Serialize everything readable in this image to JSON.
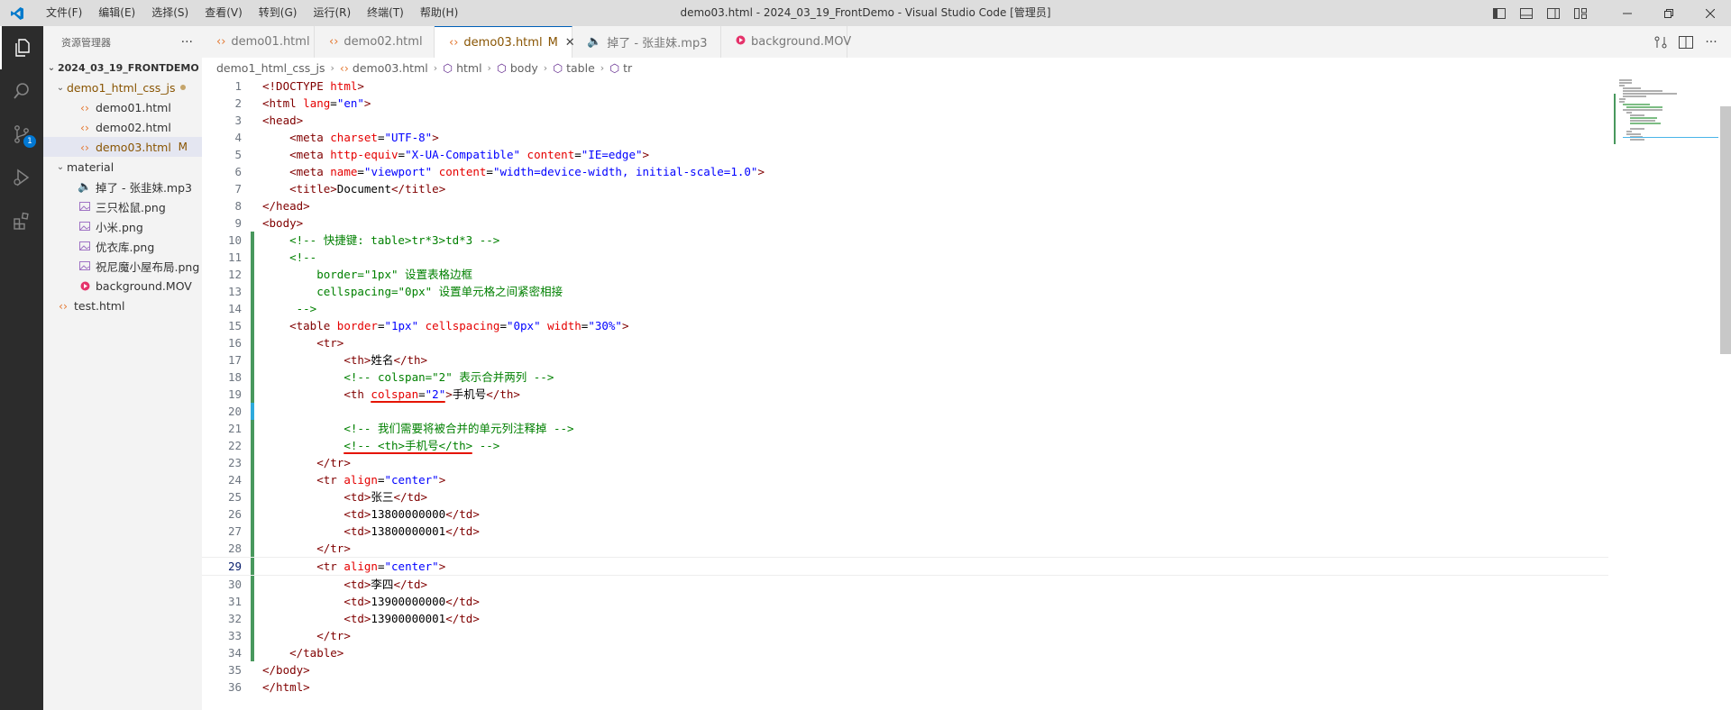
{
  "title_bar": {
    "menu": [
      "文件(F)",
      "编辑(E)",
      "选择(S)",
      "查看(V)",
      "转到(G)",
      "运行(R)",
      "终端(T)",
      "帮助(H)"
    ],
    "window_title": "demo03.html - 2024_03_19_FrontDemo - Visual Studio Code [管理员]"
  },
  "activity_bar": {
    "scm_badge": "1"
  },
  "sidebar": {
    "header": "资源管理器",
    "more": "···",
    "root": "2024_03_19_FRONTDEMO",
    "folder1": "demo1_html_css_js",
    "files1": [
      "demo01.html",
      "demo02.html",
      "demo03.html"
    ],
    "modified_flag": "M",
    "folder2": "material",
    "files2": [
      "掉了 - 张韭妹.mp3",
      "三只松鼠.png",
      "小米.png",
      "优衣库.png",
      "祝尼魔小屋布局.png",
      "background.MOV"
    ],
    "test_file": "test.html"
  },
  "tabs": [
    {
      "label": "demo01.html"
    },
    {
      "label": "demo02.html"
    },
    {
      "label": "demo03.html",
      "flag": "M"
    },
    {
      "label": "掉了 - 张韭妹.mp3"
    },
    {
      "label": "background.MOV"
    }
  ],
  "breadcrumb": [
    "demo1_html_css_js",
    "demo03.html",
    "html",
    "body",
    "table",
    "tr"
  ],
  "code": {
    "current_line": 29,
    "lines": [
      "<!DOCTYPE html>",
      "<html lang=\"en\">",
      "<head>",
      "    <meta charset=\"UTF-8\">",
      "    <meta http-equiv=\"X-UA-Compatible\" content=\"IE=edge\">",
      "    <meta name=\"viewport\" content=\"width=device-width, initial-scale=1.0\">",
      "    <title>Document</title>",
      "</head>",
      "<body>",
      "    <!-- 快捷键: table>tr*3>td*3 -->",
      "    <!--",
      "        border=\"1px\" 设置表格边框",
      "        cellspacing=\"0px\" 设置单元格之间紧密相接",
      "     -->",
      "    <table border=\"1px\" cellspacing=\"0px\" width=\"30%\">",
      "        <tr>",
      "            <th>姓名</th>",
      "            <!-- colspan=\"2\" 表示合并两列 -->",
      "            <th colspan=\"2\">手机号</th>",
      "",
      "            <!-- 我们需要将被合并的单元列注释掉 -->",
      "            <!-- <th>手机号</th> -->",
      "        </tr>",
      "        <tr align=\"center\">",
      "            <td>张三</td>",
      "            <td>13800000000</td>",
      "            <td>13800000001</td>",
      "        </tr>",
      "        <tr align=\"center\">",
      "            <td>李四</td>",
      "            <td>13900000000</td>",
      "            <td>13900000001</td>",
      "        </tr>",
      "    </table>",
      "</body>",
      "</html>"
    ]
  },
  "colors": {
    "tag": "#800000",
    "attr": "#e50000",
    "value": "#0000ff",
    "comment": "#008000",
    "accent": "#005fb8",
    "underline": "#e51400"
  }
}
